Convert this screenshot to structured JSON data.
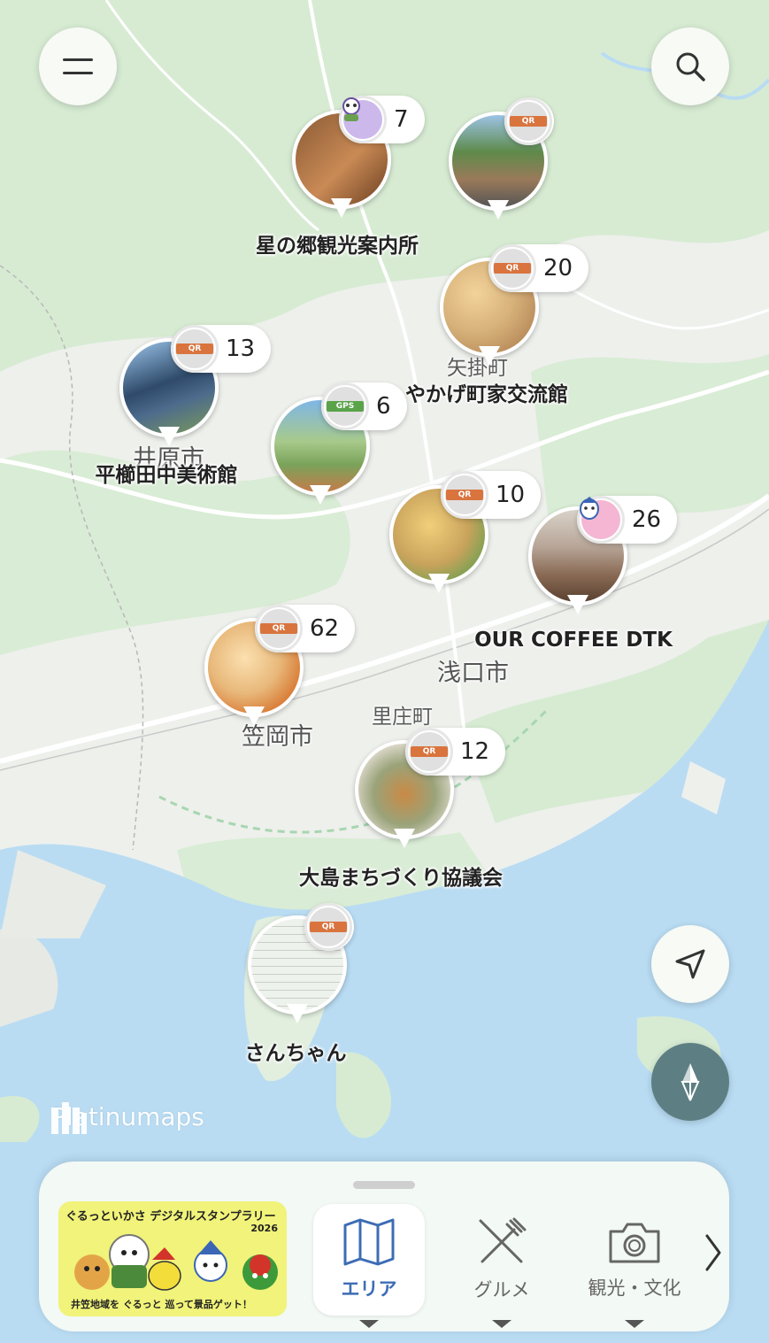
{
  "map": {
    "watermark": "Platinumaps",
    "towns": [
      "矢掛町",
      "里庄町"
    ],
    "cities": [
      "井原市",
      "浅口市",
      "笠岡市"
    ]
  },
  "spots": [
    {
      "label": "星の郷観光案内所",
      "badge": "avatar",
      "count": "7",
      "photo_color": "#8a5a35"
    },
    {
      "label": "",
      "badge": "QR",
      "count": "",
      "photo_color": "#6e8a5a"
    },
    {
      "label": "やかげ町家交流館",
      "badge": "QR",
      "count": "20",
      "photo_color": "#d7b27a"
    },
    {
      "label": "平櫛田中美術館",
      "badge": "QR",
      "count": "13",
      "photo_color": "#4d6b8c"
    },
    {
      "label": "",
      "badge": "GPS",
      "count": "6",
      "photo_color": "#7aa35a"
    },
    {
      "label": "",
      "badge": "QR",
      "count": "10",
      "photo_color": "#c9a35c"
    },
    {
      "label": "OUR COFFEE DTK",
      "badge": "avatar",
      "count": "26",
      "photo_color": "#8a6b55"
    },
    {
      "label": "",
      "badge": "QR",
      "count": "62",
      "photo_color": "#e8b87a"
    },
    {
      "label": "大島まちづくり協議会",
      "badge": "QR",
      "count": "12",
      "photo_color": "#9aa37a"
    },
    {
      "label": "さんちゃん",
      "badge": "QR",
      "count": "",
      "photo_color": "#dfe7dc"
    }
  ],
  "badge_colors": {
    "QR": "#d9743e",
    "GPS": "#5aa34a"
  },
  "controls": {
    "menu_icon": "menu-icon",
    "search_icon": "search-icon",
    "locate_icon": "navigation-arrow-icon",
    "compass_icon": "compass-icon"
  },
  "bottom_bar": {
    "banner": {
      "title": "ぐるっといかさ デジタルスタンプラリー",
      "year": "2026",
      "subtitle": "井笠地域を ぐるっと 巡って景品ゲット！"
    },
    "tabs": [
      {
        "label": "エリア",
        "icon": "map-icon",
        "active": true
      },
      {
        "label": "グルメ",
        "icon": "fork-knife-icon",
        "active": false
      },
      {
        "label": "観光・文化",
        "icon": "camera-icon",
        "active": false
      }
    ],
    "next_icon": "chevron-right-icon"
  },
  "colors": {
    "accent": "#3d6cb5",
    "sea": "#b9dcf3",
    "land": "#eef0ec",
    "green": "#d7ebd3"
  }
}
